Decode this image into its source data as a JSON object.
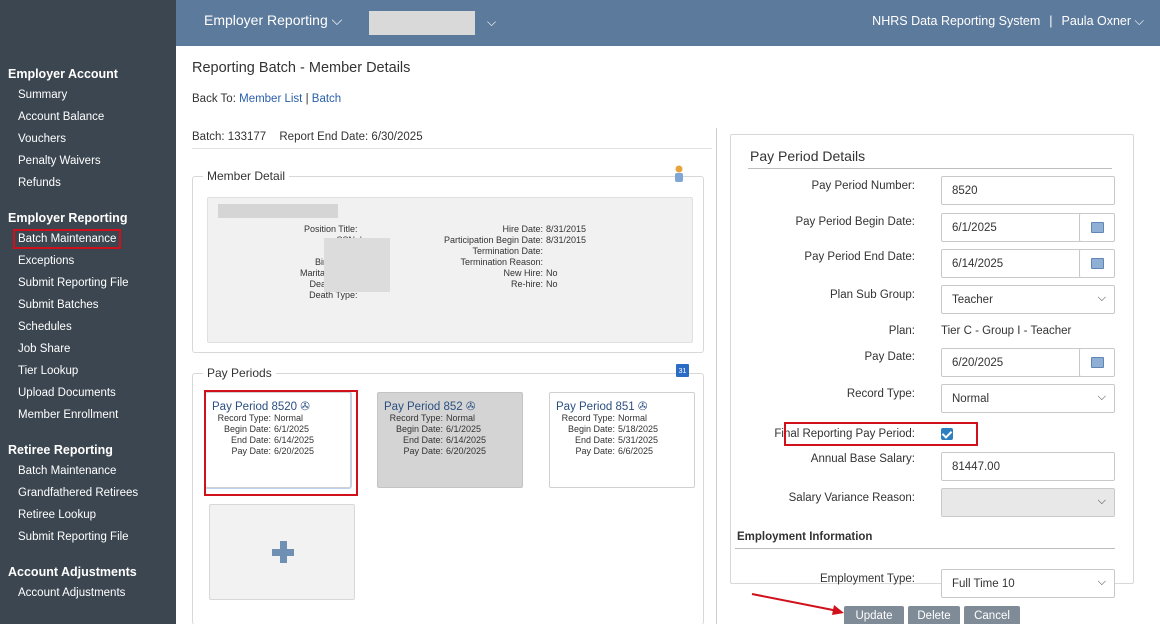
{
  "topbar": {
    "app_menu": "Employer Reporting",
    "system_title": "NHRS Data Reporting System",
    "separator": "|",
    "user_name": "Paula Oxner"
  },
  "sidebar": {
    "sections": [
      {
        "heading": "Employer Account",
        "items": [
          "Summary",
          "Account Balance",
          "Vouchers",
          "Penalty Waivers",
          "Refunds"
        ]
      },
      {
        "heading": "Employer Reporting",
        "items": [
          "Batch Maintenance",
          "Exceptions",
          "Submit Reporting File",
          "Submit Batches",
          "Schedules",
          "Job Share",
          "Tier Lookup",
          "Upload Documents",
          "Member Enrollment"
        ]
      },
      {
        "heading": "Retiree Reporting",
        "items": [
          "Batch Maintenance",
          "Grandfathered Retirees",
          "Retiree Lookup",
          "Submit Reporting File"
        ]
      },
      {
        "heading": "Account Adjustments",
        "items": [
          "Account Adjustments"
        ]
      }
    ]
  },
  "page": {
    "title": "Reporting Batch - Member Details",
    "back_to_label": "Back To:",
    "back_links": [
      "Member List",
      "Batch"
    ],
    "back_sep": "|",
    "batch_label": "Batch: 133177",
    "report_end_label": "Report End Date: 6/30/2025"
  },
  "member_detail": {
    "legend": "Member Detail",
    "left_labels": [
      "Position Title:",
      "SSN:",
      "Gender:",
      "Birth Date:",
      "Marital Status:",
      "Death Date:",
      "Death Type:"
    ],
    "left_values": [
      "",
      "'",
      "I",
      "!",
      "!",
      "",
      ""
    ],
    "right_rows": [
      {
        "label": "Hire Date:",
        "value": "8/31/2015"
      },
      {
        "label": "Participation Begin Date:",
        "value": "8/31/2015"
      },
      {
        "label": "Termination Date:",
        "value": ""
      },
      {
        "label": "Termination Reason:",
        "value": ""
      },
      {
        "label": "New Hire:",
        "value": "No"
      },
      {
        "label": "Re-hire:",
        "value": "No"
      }
    ]
  },
  "pay_periods": {
    "legend": "Pay Periods",
    "calendar_text": "31",
    "cards": [
      {
        "title": "Pay Period 8520 ✇",
        "record_type": "Normal",
        "begin": "6/1/2025",
        "end": "6/14/2025",
        "pay": "6/20/2025"
      },
      {
        "title": "Pay Period 852 ✇",
        "record_type": "Normal",
        "begin": "6/1/2025",
        "end": "6/14/2025",
        "pay": "6/20/2025"
      },
      {
        "title": "Pay Period 851 ✇",
        "record_type": "Normal",
        "begin": "5/18/2025",
        "end": "5/31/2025",
        "pay": "6/6/2025"
      }
    ],
    "labels": {
      "record_type": "Record Type:",
      "begin": "Begin Date:",
      "end": "End Date:",
      "pay": "Pay Date:"
    }
  },
  "details": {
    "title": "Pay Period Details",
    "pay_period_number_label": "Pay Period Number:",
    "pay_period_number": "8520",
    "begin_label": "Pay Period Begin Date:",
    "begin": "6/1/2025",
    "end_label": "Pay Period End Date:",
    "end": "6/14/2025",
    "plan_sub_group_label": "Plan Sub Group:",
    "plan_sub_group": "Teacher",
    "plan_label": "Plan:",
    "plan": "Tier C - Group I - Teacher",
    "pay_date_label": "Pay Date:",
    "pay_date": "6/20/2025",
    "record_type_label": "Record Type:",
    "record_type": "Normal",
    "final_label": "Final Reporting Pay Period:",
    "final_checked": true,
    "annual_salary_label": "Annual Base Salary:",
    "annual_salary": "81447.00",
    "salary_variance_label": "Salary Variance Reason:",
    "salary_variance": "",
    "employment_title": "Employment Information",
    "employment_type_label": "Employment Type:",
    "employment_type": "Full Time 10"
  },
  "buttons": {
    "update": "Update",
    "delete": "Delete",
    "cancel": "Cancel"
  },
  "colors": {
    "sidebar": "#3c4650",
    "topbar": "#5c7a9b",
    "highlight": "#d0101a",
    "button": "#7f8b97",
    "link": "#2a5faa"
  }
}
